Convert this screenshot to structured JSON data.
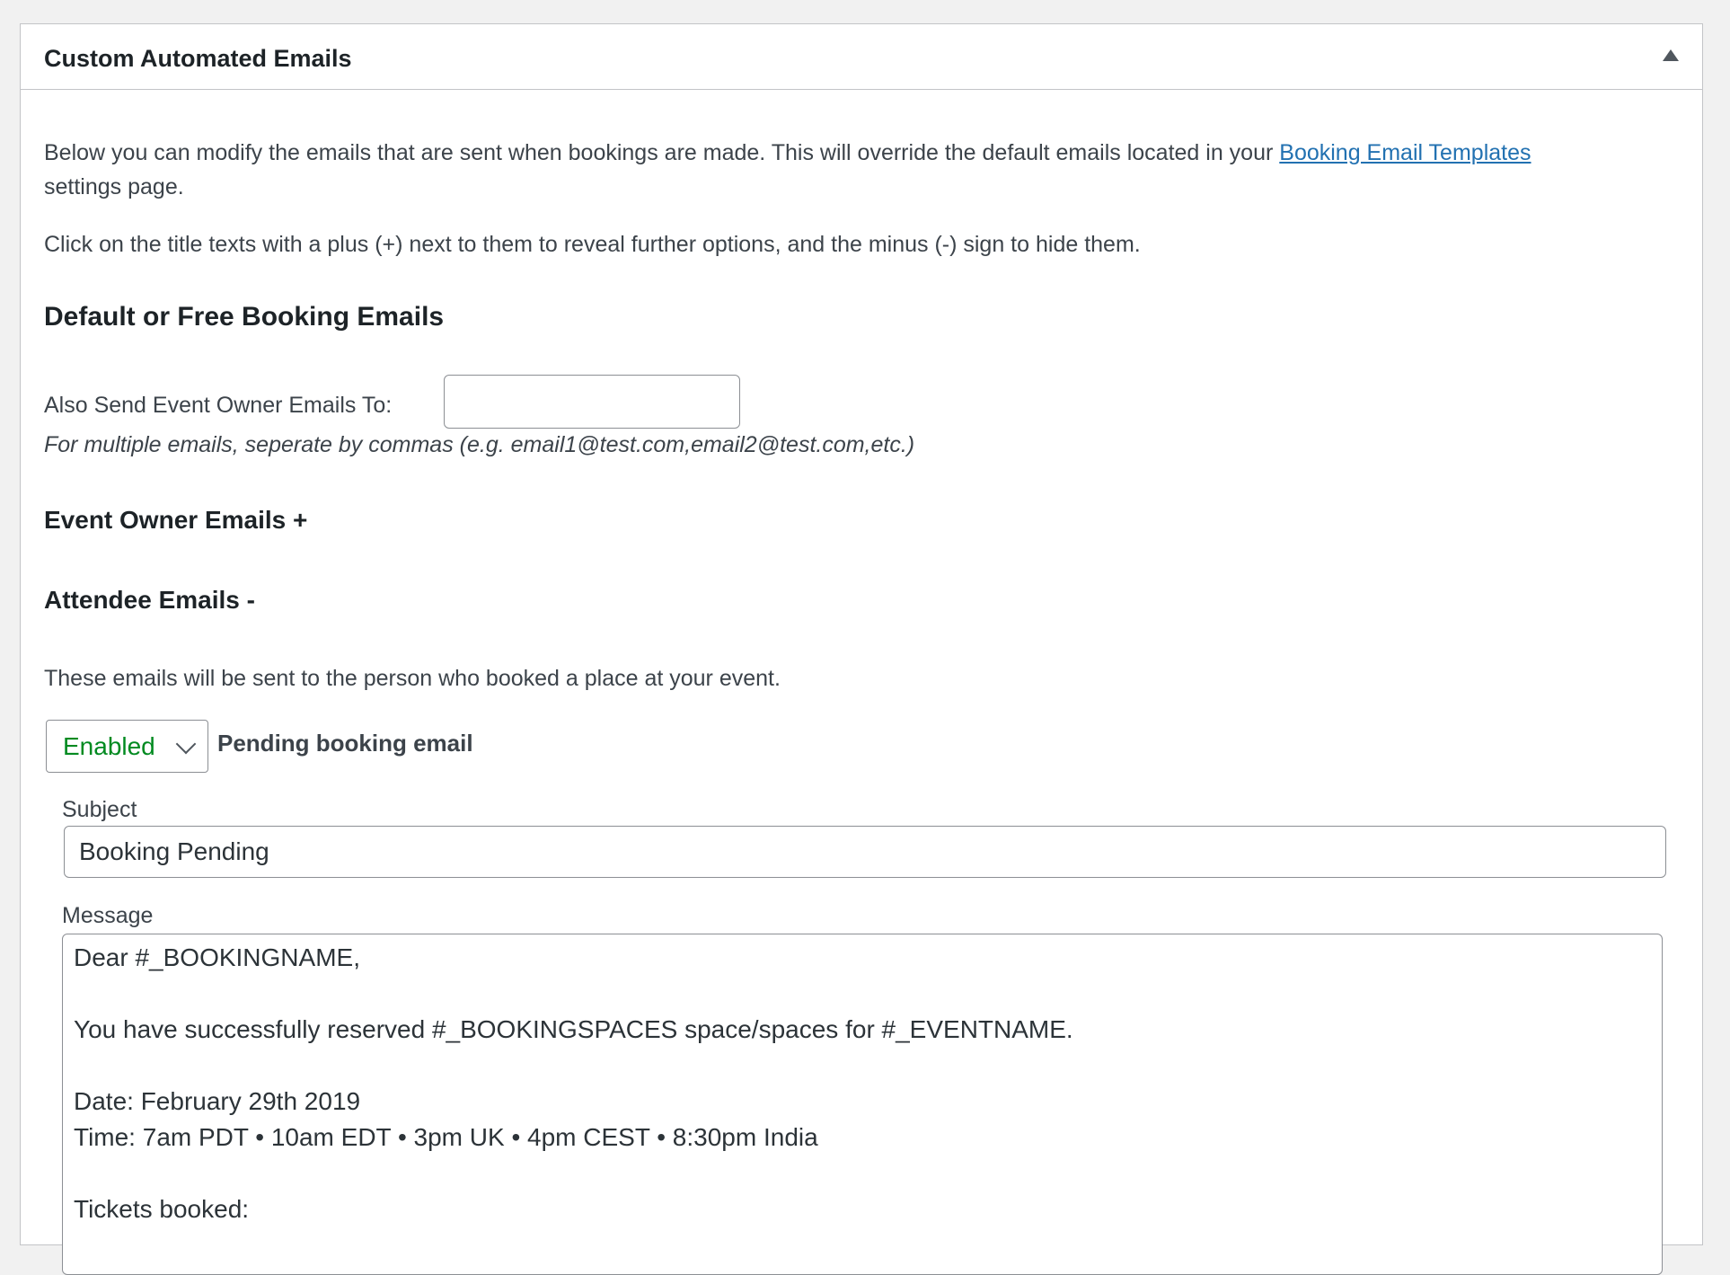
{
  "panel": {
    "title": "Custom Automated Emails"
  },
  "intro": {
    "line1_before_link": "Below you can modify the emails that are sent when bookings are made. This will override the default emails located in your ",
    "link_text": "Booking Email Templates",
    "line2": "settings page.",
    "instruction": "Click on the title texts with a plus (+) next to them to reveal further options, and the minus (-) sign to hide them."
  },
  "section": {
    "heading": "Default or Free Booking Emails",
    "owner_label": "Also Send Event Owner Emails To:",
    "owner_value": "",
    "owner_hint": "For multiple emails, seperate by commas (e.g. email1@test.com,email2@test.com,etc.)",
    "event_owner_heading": "Event Owner Emails +",
    "attendee_heading": "Attendee Emails -",
    "attendee_description": "These emails will be sent to the person who booked a place at your event."
  },
  "pending_email": {
    "status": "Enabled",
    "status_color": "#008a20",
    "label": "Pending booking email",
    "subject_label": "Subject",
    "subject_value": "Booking Pending",
    "message_label": "Message",
    "message_lines": [
      "Dear #_BOOKINGNAME,",
      "",
      "You have successfully reserved #_BOOKINGSPACES space/spaces for #_EVENTNAME.",
      "",
      "Date: February 29th 2019",
      "Time: 7am PDT • 10am EDT • 3pm UK • 4pm CEST • 8:30pm India",
      "",
      "Tickets booked:"
    ]
  },
  "icons": {
    "toggle": "triangle-up-icon",
    "select": "chevron-down-icon"
  }
}
